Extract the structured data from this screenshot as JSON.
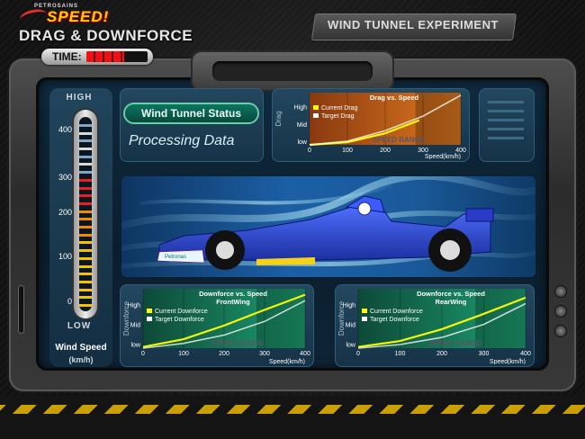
{
  "header": {
    "brand_small": "PETROSAINS",
    "brand_big": "SPEED!",
    "title": "DRAG & DOWNFORCE",
    "experiment_title": "WIND TUNNEL EXPERIMENT"
  },
  "timer": {
    "label": "TIME:",
    "remaining_fraction": 0.62
  },
  "gauge": {
    "high_label": "HIGH",
    "low_label": "LOW",
    "scale": [
      "400",
      "300",
      "200",
      "100",
      "0"
    ],
    "title": "Wind Speed",
    "unit": "(km/h)",
    "current_value": 290
  },
  "status": {
    "badge": "Wind Tunnel Status",
    "text": "Processing Data"
  },
  "car": {
    "sponsor_text": "Petronas"
  },
  "colors": {
    "current_line": "#ffff00",
    "target_line": "#ffffff"
  },
  "chart_data": [
    {
      "type": "line",
      "title": "Drag vs. Speed",
      "xlabel": "Speed(km/h)",
      "ylabel": "Drag",
      "x_ticks": [
        "0",
        "100",
        "200",
        "300",
        "400"
      ],
      "y_ticks": [
        "low",
        "Mid",
        "High"
      ],
      "xlim": [
        0,
        400
      ],
      "ylim": [
        0,
        1
      ],
      "band_label": "SPEED RANGE",
      "band_range": [
        280,
        400
      ],
      "series": [
        {
          "name": "Current Drag",
          "x": [
            0,
            100,
            200,
            290
          ],
          "y": [
            0.0,
            0.05,
            0.22,
            0.47
          ]
        },
        {
          "name": "Target Drag",
          "x": [
            0,
            100,
            200,
            300,
            400
          ],
          "y": [
            0.0,
            0.07,
            0.27,
            0.55,
            0.95
          ]
        }
      ],
      "theme": "orange"
    },
    {
      "type": "line",
      "title": "Downforce vs. Speed",
      "subtitle": "FrontWing",
      "xlabel": "Speed(km/h)",
      "ylabel": "Downforce",
      "x_ticks": [
        "0",
        "100",
        "200",
        "300",
        "400"
      ],
      "y_ticks": [
        "low",
        "Mid",
        "High"
      ],
      "xlim": [
        0,
        400
      ],
      "ylim": [
        0,
        1
      ],
      "band_label": "SPEED RANGE",
      "band_range": [
        280,
        400
      ],
      "series": [
        {
          "name": "Current Downforce",
          "x": [
            0,
            100,
            200,
            290,
            400
          ],
          "y": [
            0.02,
            0.15,
            0.38,
            0.62,
            0.9
          ]
        },
        {
          "name": "Target Downforce",
          "x": [
            0,
            100,
            200,
            300,
            400
          ],
          "y": [
            0.0,
            0.08,
            0.22,
            0.45,
            0.8
          ]
        }
      ],
      "theme": "green"
    },
    {
      "type": "line",
      "title": "Downforce vs. Speed",
      "subtitle": "RearWing",
      "xlabel": "Speed(km/h)",
      "ylabel": "Downforce",
      "x_ticks": [
        "0",
        "100",
        "200",
        "300",
        "400"
      ],
      "y_ticks": [
        "low",
        "Mid",
        "High"
      ],
      "xlim": [
        0,
        400
      ],
      "ylim": [
        0,
        1
      ],
      "band_label": "SPEED RANGE",
      "band_range": [
        280,
        400
      ],
      "series": [
        {
          "name": "Current Downforce",
          "x": [
            0,
            100,
            200,
            290,
            400
          ],
          "y": [
            0.02,
            0.12,
            0.32,
            0.55,
            0.85
          ]
        },
        {
          "name": "Target Downforce",
          "x": [
            0,
            100,
            200,
            300,
            400
          ],
          "y": [
            0.0,
            0.06,
            0.18,
            0.4,
            0.75
          ]
        }
      ],
      "theme": "green"
    }
  ]
}
